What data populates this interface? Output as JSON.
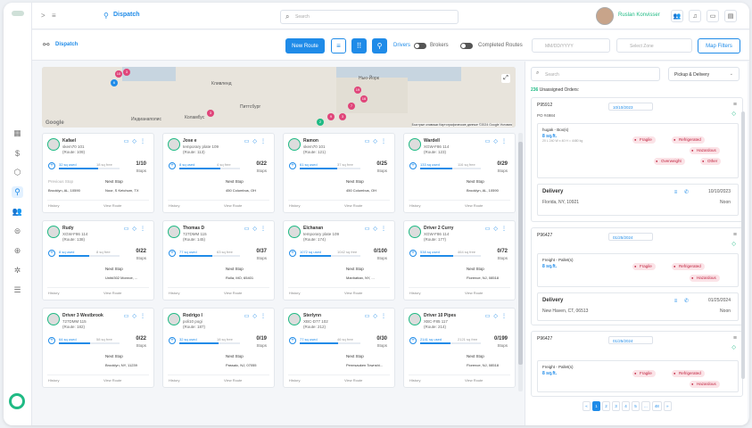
{
  "app": {
    "title": "Dispatch",
    "breadcrumb_arrow": ">",
    "menu_icon": "≡"
  },
  "topbar": {
    "search_placeholder": "Search",
    "user_name": "Ruslan Konvisser"
  },
  "toolbar": {
    "title": "Dispatch",
    "new_route": "New Route",
    "drivers_label": "Drivers",
    "brokers_label": "Brokers",
    "completed_label": "Completed Routes",
    "date_placeholder": "MM/DD/YYYY",
    "zone_placeholder": "Select Zone",
    "map_filters": "Map Filters"
  },
  "map": {
    "labels": [
      "Ченнинг",
      "Кливленд",
      "Питтсбург",
      "Торонто",
      "Нью-Йорк",
      "Коламбус",
      "Индианаполис"
    ],
    "copyright": "Быстрые клавиши   Картографические данные ©2024 Google   Условия",
    "google": "Google"
  },
  "cards": [
    {
      "name": "Kafael",
      "line1": "skem70 101",
      "line2": "(Route: 109)",
      "used": "32 sq used",
      "free": "18 sq free",
      "stops": "1/10",
      "stops_label": "Stops",
      "prev": "Previous Stop",
      "next": "Next Stop",
      "addr1": "Brooklyn, AL, 10590",
      "addr2": "Noor, S Ketchum, TX",
      "history": "History",
      "view": "View Route",
      "fill": 0.64
    },
    {
      "name": "Jose e",
      "line1": "temporary plate 109",
      "line2": "(Route: 113)",
      "used": "8 sq used",
      "free": "4 sq free",
      "stops": "0/22",
      "stops_label": "Stops",
      "prev": "",
      "next": "Next Stop",
      "addr1": "",
      "addr2": "450 Columbus, OH",
      "history": "History",
      "view": "View Route",
      "fill": 0.67
    },
    {
      "name": "Ramon",
      "line1": "skem70 101",
      "line2": "(Route: 121)",
      "used": "61 sq used",
      "free": "37 sq free",
      "stops": "0/25",
      "stops_label": "Stops",
      "prev": "",
      "next": "Next Stop",
      "addr1": "",
      "addr2": "450 Columbus, OH",
      "history": "History",
      "view": "View Route",
      "fill": 0.62
    },
    {
      "name": "Wardell",
      "line1": "XGW-F86 114",
      "line2": "(Route: 123)",
      "used": "133 sq used",
      "free": "116 sq free",
      "stops": "0/29",
      "stops_label": "Stops",
      "prev": "",
      "next": "Next Stop",
      "addr1": "",
      "addr2": "Brooklyn, AL, 10590",
      "history": "History",
      "view": "View Route",
      "fill": 0.53
    },
    {
      "name": "Rudy",
      "line1": "XGW-F86 114",
      "line2": "(Route: 138)",
      "used": "8 sq used",
      "free": "8 sq free",
      "stops": "0/22",
      "stops_label": "Stops",
      "prev": "",
      "next": "Next Stop",
      "addr1": "",
      "addr2": "Unit#302 Monroe, ...",
      "history": "History",
      "view": "View Route",
      "fill": 0.5
    },
    {
      "name": "Thomas D",
      "line1": "727DMM 115",
      "line2": "(Route: 145)",
      "used": "77 sq used",
      "free": "63 sq free",
      "stops": "0/37",
      "stops_label": "Stops",
      "prev": "",
      "next": "Next Stop",
      "addr1": "",
      "addr2": "Rolla, MO, 65401",
      "history": "History",
      "view": "View Route",
      "fill": 0.55
    },
    {
      "name": "Elchanan",
      "line1": "temporary plate 109",
      "line2": "(Route: 174)",
      "used": "1072 sq used",
      "free": "1042 sq free",
      "stops": "0/100",
      "stops_label": "Stops",
      "prev": "",
      "next": "Next Stop",
      "addr1": "",
      "addr2": "Manhattan, NY, ...",
      "history": "History",
      "view": "View Route",
      "fill": 0.51
    },
    {
      "name": "Driver 2 Curry",
      "line1": "XGW-F86 114",
      "line2": "(Route: 177)",
      "used": "538 sq used",
      "free": "464 sq free",
      "stops": "0/72",
      "stops_label": "Stops",
      "prev": "",
      "next": "Next Stop",
      "addr1": "",
      "addr2": "Florence, NJ, 08518",
      "history": "History",
      "view": "View Route",
      "fill": 0.54
    },
    {
      "name": "Driver 3 Westbrook",
      "line1": "727DMM 115",
      "line2": "(Route: 182)",
      "used": "64 sq used",
      "free": "58 sq free",
      "stops": "0/22",
      "stops_label": "Stops",
      "prev": "",
      "next": "Next Stop",
      "addr1": "",
      "addr2": "Brooklyn, NY, 11239",
      "history": "History",
      "view": "View Route",
      "fill": 0.52
    },
    {
      "name": "Rodrigo I",
      "line1": "poli10 pogi",
      "line2": "(Route: 187)",
      "used": "32 sq used",
      "free": "18 sq free",
      "stops": "0/19",
      "stops_label": "Stops",
      "prev": "",
      "next": "Next Stop",
      "addr1": "",
      "addr2": "Passaic, NJ, 07055",
      "history": "History",
      "view": "View Route",
      "fill": 0.64
    },
    {
      "name": "Sterlynn",
      "line1": "XBC-D77 102",
      "line2": "(Route: 212)",
      "used": "77 sq used",
      "free": "46 sq free",
      "stops": "0/30",
      "stops_label": "Stops",
      "prev": "",
      "next": "Next Stop",
      "addr1": "",
      "addr2": "Pennsauken Townshi...",
      "history": "History",
      "view": "View Route",
      "fill": 0.63
    },
    {
      "name": "Driver 10 Pipes",
      "line1": "XBC-F85 117",
      "line2": "(Route: 214)",
      "used": "2141 sq used",
      "free": "2121 sq free",
      "stops": "0/199",
      "stops_label": "Stops",
      "prev": "",
      "next": "Next Stop",
      "addr1": "",
      "addr2": "Florence, NJ, 08518",
      "history": "History",
      "view": "View Route",
      "fill": 0.5
    }
  ],
  "panel": {
    "search_placeholder": "Search",
    "filter": "Pickup & Delivery",
    "count_num": "236",
    "count_label": " Unassigned Orders:",
    "orders": [
      {
        "id": "P95912",
        "po": "PO #4984",
        "date": "10/10/2023",
        "freight": "hugak - Box(s)",
        "sq": "8 sq.ft.",
        "dim": "20 L 240 W x 40 H = 4480 kg",
        "tags": [
          "Fragile",
          "Refrigerated",
          "Hazardous",
          "Overweight",
          "Other"
        ],
        "delivery": "Delivery",
        "address": "Florida, NY, 10921",
        "ddate": "10/10/2023",
        "time": "Noon"
      },
      {
        "id": "P96427",
        "po": "",
        "date": "01/25/2024",
        "freight": "Freight - Pallet(s)",
        "sq": "8 sq.ft.",
        "dim": "",
        "tags": [
          "Fragile",
          "Refrigerated",
          "Hazardous"
        ],
        "delivery": "Delivery",
        "address": "New Haven, CT, 06513",
        "ddate": "01/25/2024",
        "time": "Noon"
      },
      {
        "id": "P96427",
        "po": "",
        "date": "01/25/2024",
        "freight": "Freight - Pallet(s)",
        "sq": "8 sq.ft.",
        "dim": "",
        "tags": [
          "Fragile",
          "Refrigerated",
          "Hazardous"
        ],
        "delivery": "",
        "address": "",
        "ddate": "",
        "time": ""
      }
    ],
    "pages": [
      "«",
      "1",
      "2",
      "3",
      "4",
      "5",
      "...",
      "48",
      "»"
    ]
  }
}
